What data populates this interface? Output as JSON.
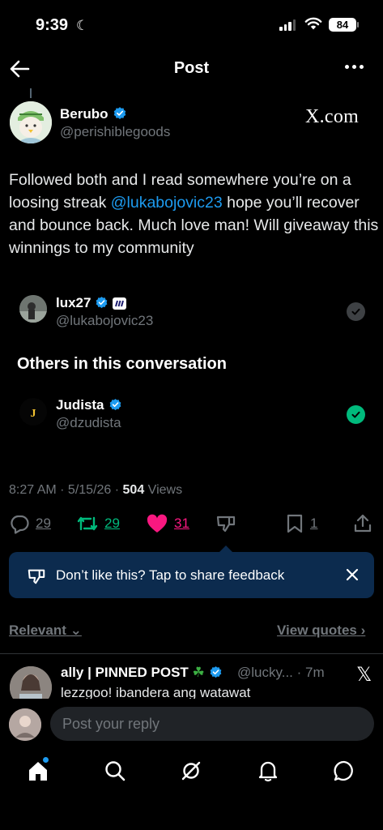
{
  "status_bar": {
    "time": "9:39",
    "battery": "84"
  },
  "header": {
    "title": "Post"
  },
  "post": {
    "author_name": "Berubo",
    "author_handle": "@perishiblegoods",
    "source_label": "X.com",
    "text_1": "Followed both and I read somewhere you’re on a loosing streak ",
    "mention": "@lukabojovic23",
    "text_2": " hope you’ll recover and bounce back. Much love man! Will giveaway this winnings to my community"
  },
  "tagged_account": {
    "name": "lux27",
    "handle": "@lukabojovic23"
  },
  "others": {
    "heading": "Others in this conversation",
    "name": "Judista",
    "handle": "@dzudista",
    "avatar_letter": "J"
  },
  "meta": {
    "time_date": "8:27 AM · 5/15/26 · ",
    "views_count": "504",
    "views_label": " Views"
  },
  "actions": {
    "replies": "29",
    "reposts": "29",
    "likes": "31",
    "bookmarks": "1"
  },
  "colors": {
    "accent": "#1d9bf0",
    "like": "#f91880",
    "repost": "#00ba7c",
    "tooltip_bg": "#0c2b4e"
  },
  "feedback": {
    "text": "Don’t like this? Tap to share feedback"
  },
  "sort": {
    "relevant": "Relevant",
    "view_quotes": "View quotes"
  },
  "reply": {
    "name": "ally | PINNED POST",
    "handle_time": "@lucky... · 7m",
    "text": "lezzgoo! ibandera ang watawat"
  },
  "composer": {
    "placeholder": "Post your reply"
  },
  "bottom_nav": [
    "home-icon",
    "search-icon",
    "grok-icon",
    "notifications-icon",
    "messages-icon"
  ]
}
